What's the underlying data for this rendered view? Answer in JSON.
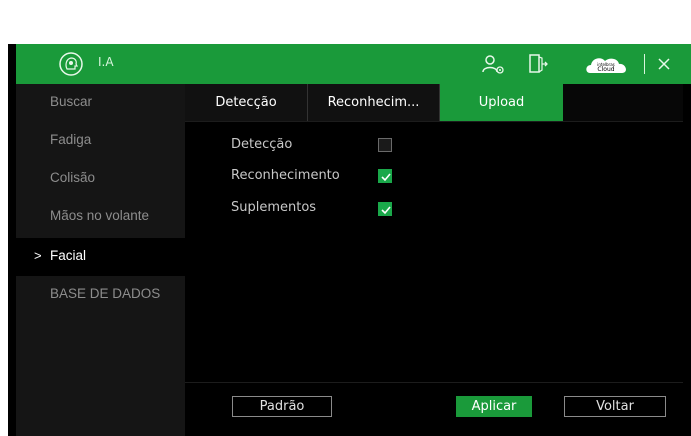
{
  "app": {
    "title": "I.A",
    "logo_icon": "ai-head-icon"
  },
  "toolbar": {
    "user_icon": "user-settings-icon",
    "exit_icon": "exit-door-icon",
    "cloud_icon": "intelbras-cloud-icon",
    "cloud_brand": "intelbras",
    "cloud_label": "Cloud",
    "close_icon": "close-icon"
  },
  "sidebar": {
    "items": [
      {
        "label": "Buscar"
      },
      {
        "label": "Fadiga"
      },
      {
        "label": "Colisão"
      },
      {
        "label": "Mãos no volante"
      },
      {
        "label": "Facial",
        "active": true
      },
      {
        "label": "BASE DE DADOS"
      }
    ],
    "active_marker": ">"
  },
  "tabs": [
    {
      "label": "Detecção"
    },
    {
      "label": "Reconhecim..."
    },
    {
      "label": "Upload",
      "active": true
    }
  ],
  "options": [
    {
      "label": "Detecção",
      "checked": false
    },
    {
      "label": "Reconhecimento",
      "checked": true
    },
    {
      "label": "Suplementos",
      "checked": true
    }
  ],
  "buttons": {
    "default": "Padrão",
    "apply": "Aplicar",
    "back": "Voltar"
  },
  "colors": {
    "accent": "#1a9a3a",
    "checkbox_on": "#1aa84a",
    "background": "#000000",
    "sidebar": "#151515"
  }
}
